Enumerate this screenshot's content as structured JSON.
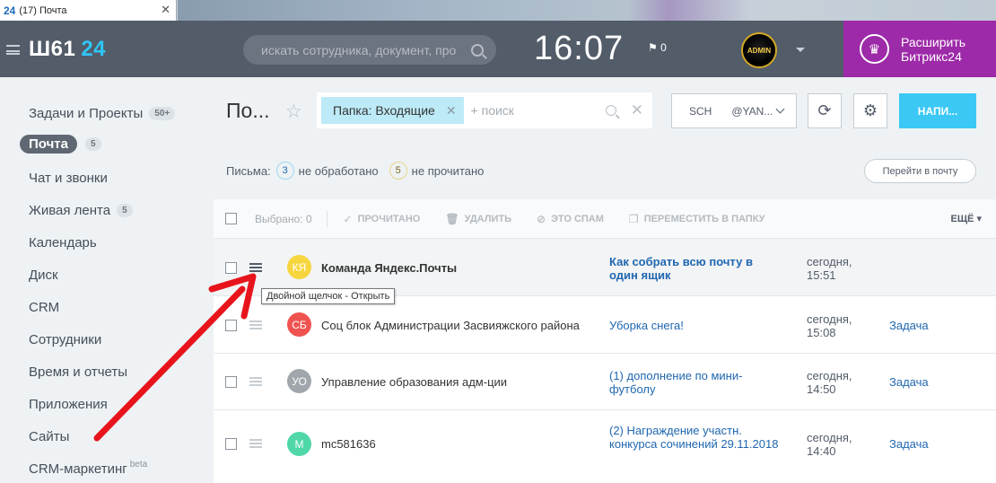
{
  "browser": {
    "tab_favicon": "24",
    "tab_title": "(17) Почта",
    "tab_close": "✕"
  },
  "header": {
    "logo_text": "Ш61",
    "logo_num": "24",
    "search_placeholder": "искать сотрудника, документ, про",
    "clock": "16:07",
    "notifications_count": "0",
    "avatar_label": "ADMIN",
    "upgrade_line1": "Расширить",
    "upgrade_line2": "Битрикс24"
  },
  "left_menu": {
    "items": [
      {
        "label": "Задачи и Проекты",
        "count": "50+"
      },
      {
        "label": "Почта",
        "count": "5"
      },
      {
        "label": "Чат и звонки",
        "count": ""
      },
      {
        "label": "Живая лента",
        "count": "5"
      },
      {
        "label": "Календарь",
        "count": ""
      },
      {
        "label": "Диск",
        "count": ""
      },
      {
        "label": "CRM",
        "count": ""
      },
      {
        "label": "Сотрудники",
        "count": ""
      },
      {
        "label": "Время и отчеты",
        "count": ""
      },
      {
        "label": "Приложения",
        "count": ""
      },
      {
        "label": "Сайты",
        "count": ""
      },
      {
        "label": "CRM-маркетинг",
        "count": "",
        "sup": "beta"
      }
    ]
  },
  "page": {
    "title": "По...",
    "filter_chip": "Папка: Входящие",
    "filter_placeholder": "+ поиск",
    "mailbox_a": "SCH",
    "mailbox_b": "@YAN...",
    "write_button": "НАПИ...",
    "stats_prefix": "Письма:",
    "stats_unprocessed_count": "3",
    "stats_unprocessed_label": "не обработано",
    "stats_unread_count": "5",
    "stats_unread_label": "не прочитано",
    "goto_mail_button": "Перейти в почту"
  },
  "toolbar": {
    "selected": "Выбрано: 0",
    "read": "ПРОЧИТАНО",
    "delete": "УДАЛИТЬ",
    "spam": "ЭТО СПАМ",
    "move": "ПЕРЕМЕСТИТЬ В ПАПКУ",
    "more": "ЕЩЁ"
  },
  "emails": [
    {
      "initials": "КЯ",
      "color": "#f7d53e",
      "from": "Команда Яндекс.Почты",
      "subject": "Как собрать всю почту в один ящик",
      "date1": "сегодня,",
      "date2": "15:51",
      "action": ""
    },
    {
      "initials": "СБ",
      "color": "#ef5350",
      "from": "Соц блок Администрации Засвияжского района",
      "subject": "Уборка снега!",
      "date1": "сегодня,",
      "date2": "15:08",
      "action": "Задача"
    },
    {
      "initials": "УО",
      "color": "#a0a6ab",
      "from": "Управление образования адм-ции",
      "subject": "(1) дополнение по мини-футболу",
      "date1": "сегодня,",
      "date2": "14:50",
      "action": "Задача"
    },
    {
      "initials": "М",
      "color": "#4fd7a8",
      "from": "mc581636",
      "subject": "(2) Награждение участн. конкурса сочинений 29.11.2018",
      "date1": "сегодня,",
      "date2": "14:40",
      "action": "Задача"
    }
  ],
  "tooltip": "Двойной щелчок - Открыть",
  "colors": {
    "header_bg": "#535c69",
    "upgrade_bg": "#9d2aa8",
    "accent": "#3bc8f5",
    "link": "#2067b0",
    "arrow": "#e8141c"
  }
}
